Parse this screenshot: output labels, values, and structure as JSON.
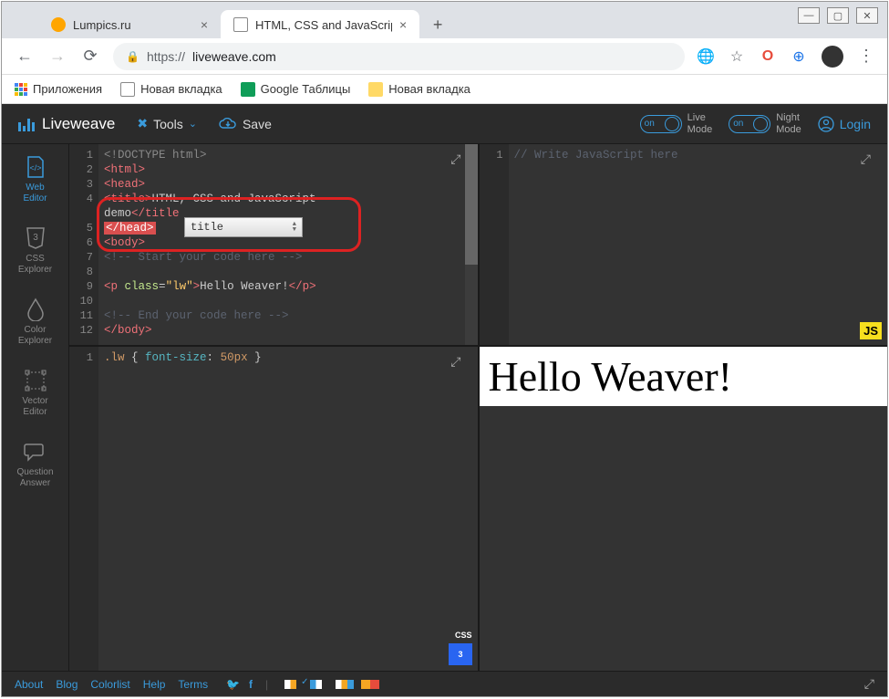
{
  "window": {
    "tabs": [
      {
        "title": "Lumpics.ru",
        "active": false
      },
      {
        "title": "HTML, CSS and JavaScript demo",
        "active": true
      }
    ],
    "url_scheme": "https://",
    "url_host": "liveweave.com"
  },
  "bookmarks": [
    {
      "label": "Приложения",
      "icon": "apps"
    },
    {
      "label": "Новая вкладка",
      "icon": "doc"
    },
    {
      "label": "Google Таблицы",
      "icon": "sheets"
    },
    {
      "label": "Новая вкладка",
      "icon": "yellow"
    }
  ],
  "app": {
    "name": "Liveweave",
    "tools": "Tools",
    "save": "Save",
    "toggles": [
      {
        "state": "on",
        "label": "Live\nMode"
      },
      {
        "state": "on",
        "label": "Night\nMode"
      }
    ],
    "login": "Login"
  },
  "sidebar": [
    {
      "label": "Web\nEditor",
      "icon": "code",
      "active": true
    },
    {
      "label": "CSS\nExplorer",
      "icon": "css"
    },
    {
      "label": "Color\nExplorer",
      "icon": "drop"
    },
    {
      "label": "Vector\nEditor",
      "icon": "vector"
    },
    {
      "label": "Question\nAnswer",
      "icon": "chat"
    }
  ],
  "html_pane": {
    "lines": [
      {
        "n": 1,
        "text": "<!DOCTYPE html>"
      },
      {
        "n": 2,
        "text": "<html>"
      },
      {
        "n": 3,
        "text": "<head>"
      },
      {
        "n": 4,
        "text": "<title>HTML, CSS and JavaScript"
      },
      {
        "n": "",
        "text": "demo</title"
      },
      {
        "n": 5,
        "text": "</head>"
      },
      {
        "n": 6,
        "text": "<body>"
      },
      {
        "n": 7,
        "text": "<!-- Start your code here -->"
      },
      {
        "n": 8,
        "text": ""
      },
      {
        "n": 9,
        "text": "<p class=\"lw\">Hello Weaver!</p>"
      },
      {
        "n": 10,
        "text": ""
      },
      {
        "n": 11,
        "text": "<!-- End your code here -->"
      },
      {
        "n": 12,
        "text": "</body>"
      }
    ],
    "autocomplete": "title"
  },
  "js_pane": {
    "lines": [
      {
        "n": 1,
        "text": "// Write JavaScript here"
      }
    ]
  },
  "css_pane": {
    "lines": [
      {
        "n": 1,
        "sel": ".lw",
        "prop": "font-size",
        "val": "50px"
      }
    ]
  },
  "preview_text": "Hello Weaver!",
  "footer": {
    "links": [
      "About",
      "Blog",
      "Colorlist",
      "Help",
      "Terms"
    ]
  },
  "css_badge_label": "CSS"
}
